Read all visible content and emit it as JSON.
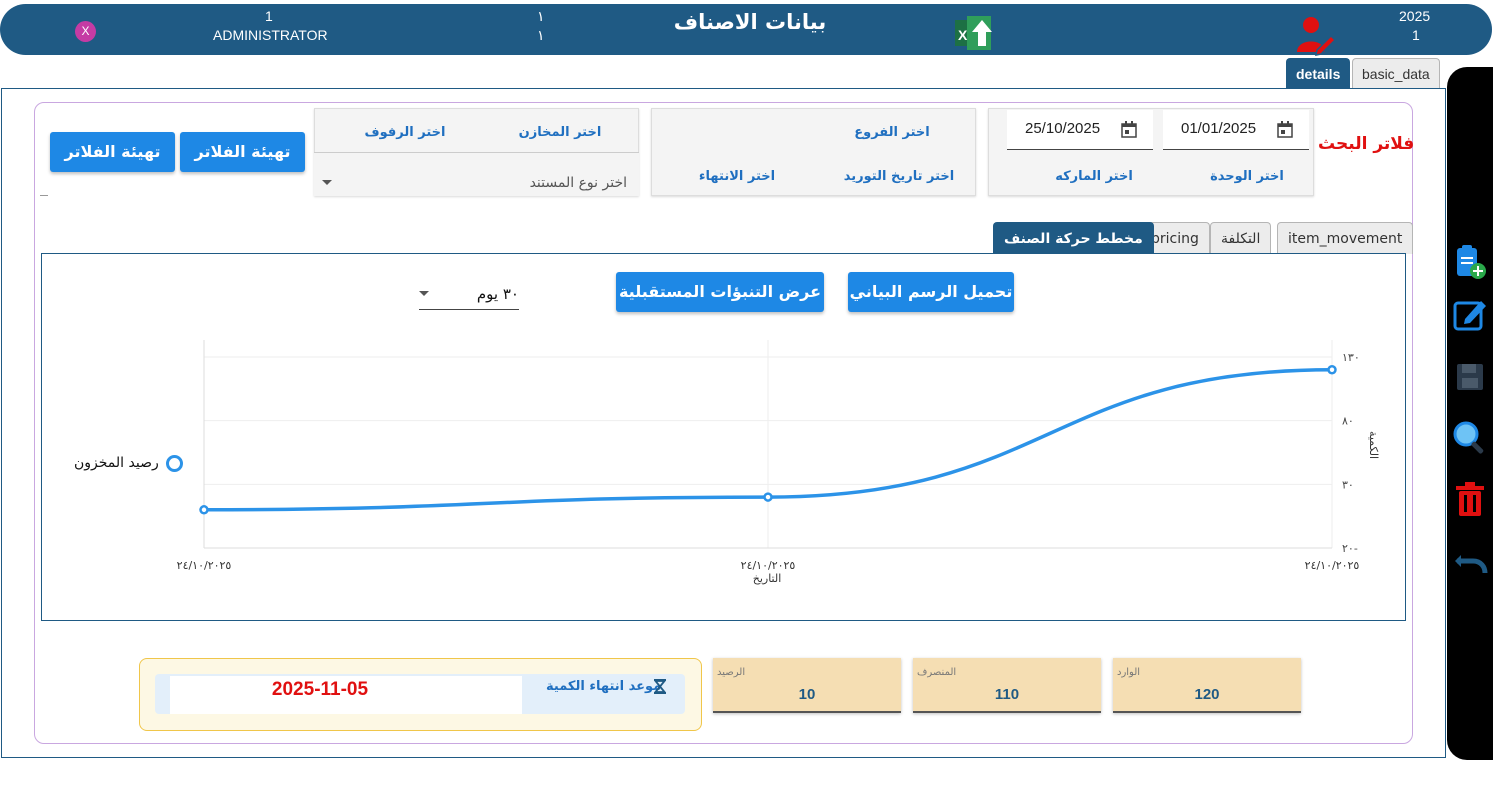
{
  "header": {
    "title": "بيانات الاصناف",
    "user_count": "1",
    "user_name": "ADMINISTRATOR",
    "close_label": "X",
    "mid_top": "١",
    "mid_bottom": "١",
    "year": "2025",
    "branch": "1"
  },
  "top_tabs": [
    {
      "label": "details",
      "active": true
    },
    {
      "label": "basic_data",
      "active": false
    }
  ],
  "filters": {
    "section_label": "فلاتر البحث",
    "date_from": "01/01/2025",
    "date_to": "25/10/2025",
    "unit": "اختر الوحدة",
    "brand": "اختر الماركه",
    "branches": "اختر الفروع",
    "supply_date": "اختر تاريخ التوريد",
    "expiry": "اختر الانتهاء",
    "stores": "اختر المخازن",
    "shelves": "اختر الرفوف",
    "doc_type_placeholder": "اختر نوع المستند",
    "reset_button_1": "تهيئة الفلاتر",
    "reset_button_2": "تهيئة الفلاتر"
  },
  "chart_tabs": [
    {
      "label": "item_movement",
      "active": false
    },
    {
      "label": "التكلفة",
      "active": false
    },
    {
      "label": "pricing",
      "active": false
    },
    {
      "label": "مخطط حركة الصنف",
      "active": true
    }
  ],
  "chart_controls": {
    "load_chart": "تحميل الرسم البياني",
    "show_forecast": "عرض التنبؤات المستقبلية",
    "period": "٣٠ يوم"
  },
  "chart_data": {
    "type": "line",
    "x": [
      "٢٤/١٠/٢٠٢٥",
      "٢٤/١٠/٢٠٢٥",
      "٢٤/١٠/٢٠٢٥"
    ],
    "series": [
      {
        "name": "رصيد المخزون",
        "values": [
          10,
          20,
          120
        ],
        "color": "#2c93e8"
      }
    ],
    "ylim": [
      -20,
      130
    ],
    "yticks": [
      {
        "value": -20,
        "label": "٢٠-"
      },
      {
        "value": 30,
        "label": "٣٠"
      },
      {
        "value": 80,
        "label": "٨٠"
      },
      {
        "value": 130,
        "label": "١٣٠"
      }
    ],
    "xlabel": "التاريخ",
    "ylabel": "الكمية",
    "grid": true,
    "legend": "left"
  },
  "stats": {
    "in_label": "الوارد",
    "in_value": "120",
    "out_label": "المنصرف",
    "out_value": "110",
    "balance_label": "الرصيد",
    "balance_value": "10"
  },
  "expiry": {
    "label": "موعد انتهاء الكمية",
    "value": "2025-11-05"
  },
  "colors": {
    "primary": "#1f5a84",
    "accent": "#1e88e5",
    "danger": "#e01010",
    "card": "#f5deb3"
  }
}
